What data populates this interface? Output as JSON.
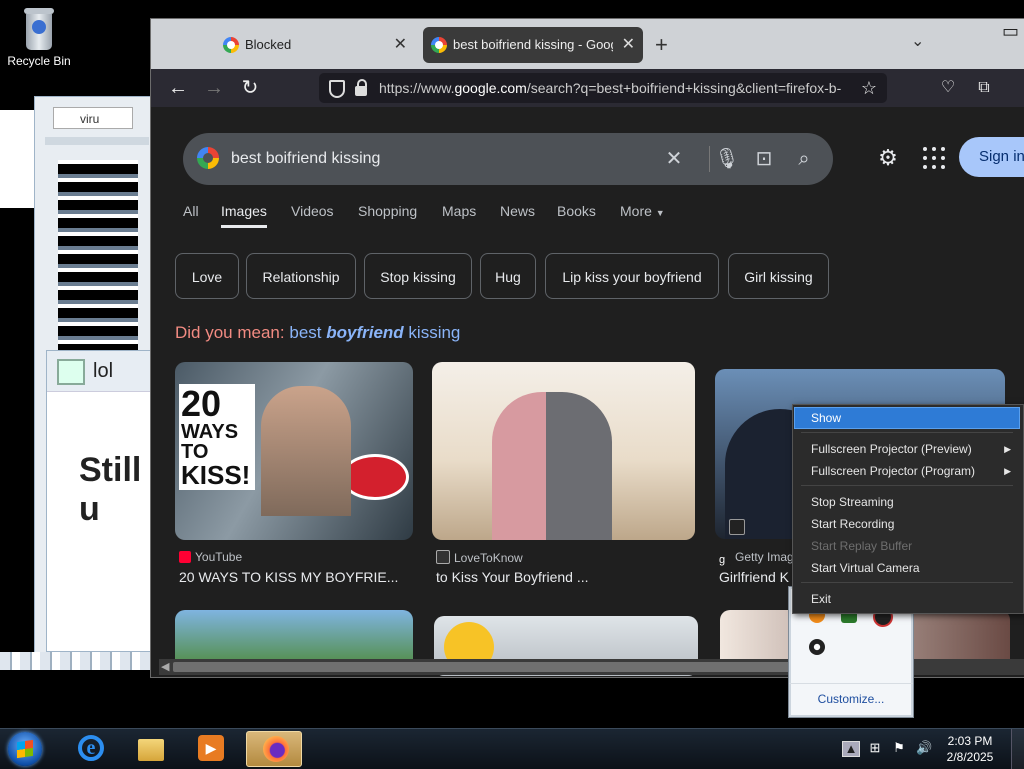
{
  "desktop": {
    "recycle_bin_label": "Recycle Bin",
    "bg_window_tab": "viru",
    "bg_window_title": "lol",
    "bg_window_text": "Still u"
  },
  "browser": {
    "tabs": [
      {
        "label": "Blocked"
      },
      {
        "label": "best boifriend kissing - Google"
      }
    ],
    "url_prefix": "https://www.",
    "url_domain": "google.com",
    "url_rest": "/search?q=best+boifriend+kissing&client=firefox-b-"
  },
  "google": {
    "query": "best boifriend kissing",
    "signin": "Sign in",
    "tabs": [
      "All",
      "Images",
      "Videos",
      "Shopping",
      "Maps",
      "News",
      "Books",
      "More"
    ],
    "active_tab": "Images",
    "chips": [
      "Love",
      "Relationship",
      "Stop kissing",
      "Hug",
      "Lip kiss your boyfriend",
      "Girl kissing"
    ],
    "did_you_mean_label": "Did you mean:",
    "did_you_mean_pre": "best",
    "did_you_mean_bold": "boyfriend",
    "did_you_mean_post": "kissing",
    "results": [
      {
        "source": "YouTube",
        "title": "20 WAYS TO KISS MY BOYFRIE...",
        "thumb_text": [
          "20",
          "WAYS",
          "TO",
          "KISS!"
        ]
      },
      {
        "source": "LoveToKnow",
        "title": "to Kiss Your Boyfriend ..."
      },
      {
        "source": "Getty Imag",
        "title": "Girlfriend K"
      }
    ]
  },
  "context_menu": {
    "items": [
      {
        "label": "Show",
        "state": "highlighted"
      },
      {
        "label": "Fullscreen Projector (Preview)",
        "submenu": true
      },
      {
        "label": "Fullscreen Projector (Program)",
        "submenu": true
      },
      {
        "label": "Stop Streaming"
      },
      {
        "label": "Start Recording"
      },
      {
        "label": "Start Replay Buffer",
        "state": "disabled"
      },
      {
        "label": "Start Virtual Camera"
      },
      {
        "label": "Exit"
      }
    ]
  },
  "tray_popup": {
    "customize": "Customize..."
  },
  "taskbar": {
    "time": "2:03 PM",
    "date": "2/8/2025",
    "pinned": [
      "internet-explorer",
      "file-explorer",
      "media-player",
      "firefox"
    ]
  },
  "colors": {
    "google_bg": "#1f1f1f",
    "link_blue": "#8ab4f8",
    "did_you_mean_red": "#f28b82",
    "menu_highlight": "#2e7bd6",
    "signin_bg": "#a8c7fa"
  }
}
